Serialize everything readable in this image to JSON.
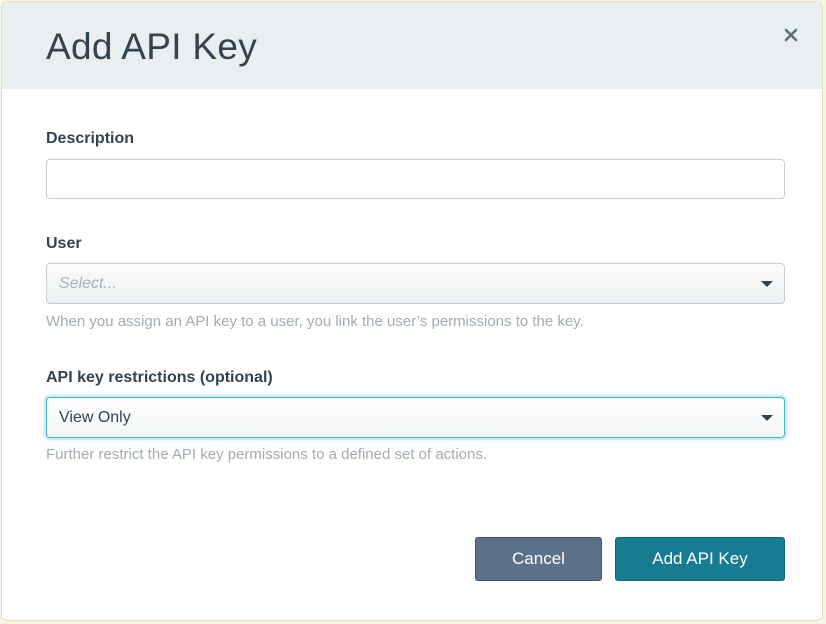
{
  "dialog": {
    "title": "Add API Key",
    "close_icon": "close-icon"
  },
  "form": {
    "description": {
      "label": "Description",
      "value": "",
      "placeholder": ""
    },
    "user": {
      "label": "User",
      "placeholder": "Select...",
      "helper": "When you assign an API key to a user, you link the user’s permissions to the key."
    },
    "restrictions": {
      "label": "API key restrictions (optional)",
      "value": "View Only",
      "helper": "Further restrict the API key permissions to a defined set of actions."
    }
  },
  "actions": {
    "cancel_label": "Cancel",
    "submit_label": "Add API Key"
  },
  "colors": {
    "header_bg": "#e9eef0",
    "cancel_button": "#5b7189",
    "primary_button": "#177c92",
    "focus_ring": "#4ab0cc"
  }
}
